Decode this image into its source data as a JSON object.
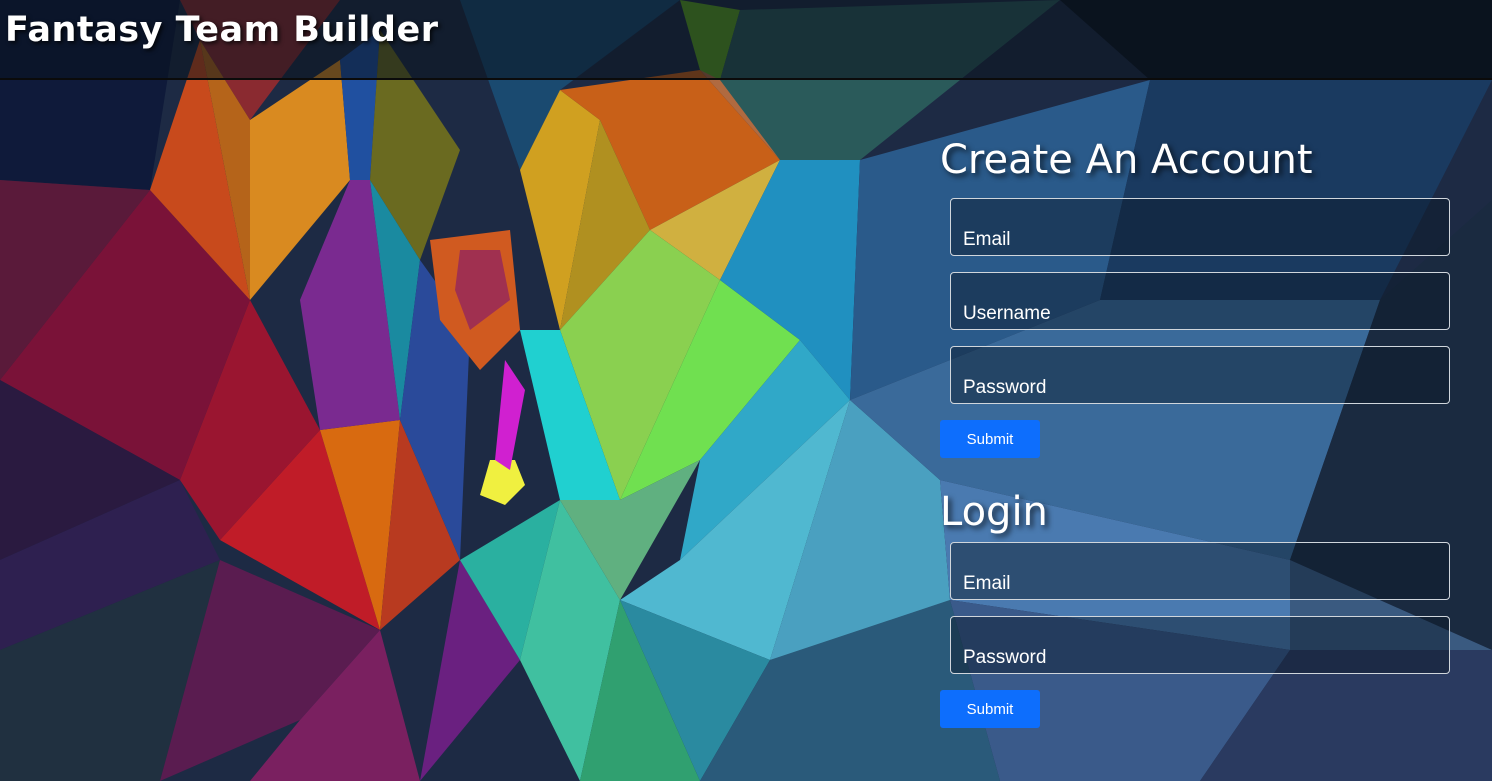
{
  "header": {
    "title": "Fantasy Team Builder"
  },
  "create_account": {
    "title": "Create An Account",
    "email_placeholder": "Email",
    "username_placeholder": "Username",
    "password_placeholder": "Password",
    "submit_label": "Submit"
  },
  "login": {
    "title": "Login",
    "email_placeholder": "Email",
    "password_placeholder": "Password",
    "submit_label": "Submit"
  },
  "colors": {
    "button": "#0d6efd",
    "text": "#ffffff"
  }
}
